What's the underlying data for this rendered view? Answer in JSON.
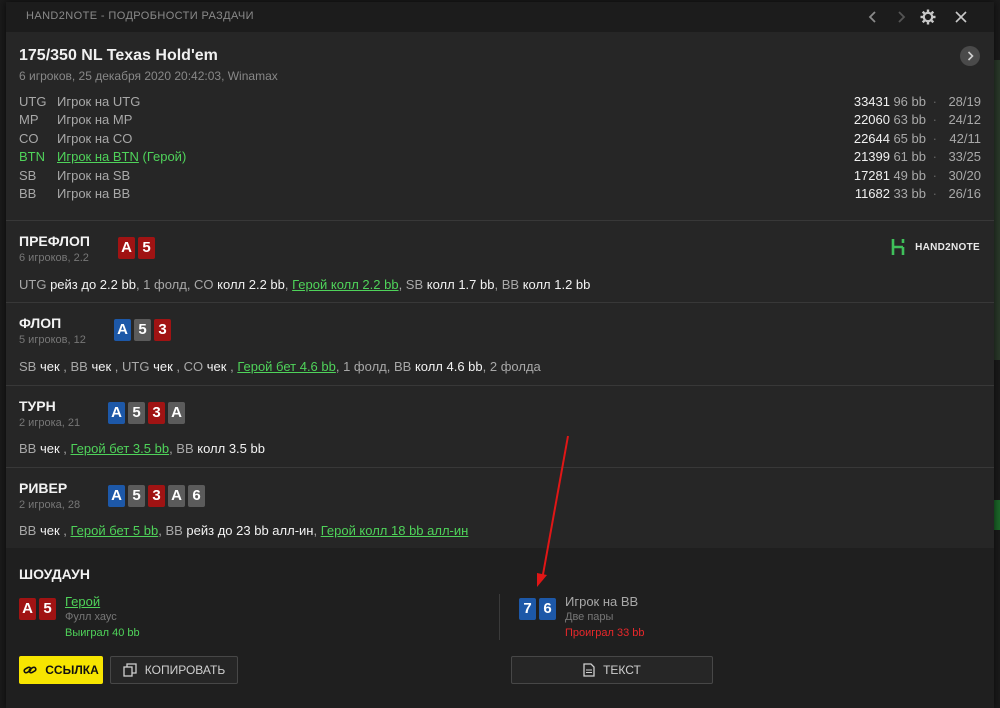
{
  "window": {
    "title": "HAND2NOTE - ПОДРОБНОСТИ РАЗДАЧИ"
  },
  "header": {
    "game_title": "175/350 NL Texas Hold'em",
    "game_subtitle": "6 игроков, 25 декабря 2020 20:42:03, Winamax"
  },
  "players": [
    {
      "pos": "UTG",
      "name": "Игрок на UTG",
      "stack": "33431",
      "bb": "96 bb",
      "ratio": "28/19",
      "hero": false
    },
    {
      "pos": "MP",
      "name": "Игрок на MP",
      "stack": "22060",
      "bb": "63 bb",
      "ratio": "24/12",
      "hero": false
    },
    {
      "pos": "CO",
      "name": "Игрок на CO",
      "stack": "22644",
      "bb": "65 bb",
      "ratio": "42/11",
      "hero": false
    },
    {
      "pos": "BTN",
      "name": "Игрок на BTN",
      "name_suffix": "(Герой)",
      "stack": "21399",
      "bb": "61 bb",
      "ratio": "33/25",
      "hero": true
    },
    {
      "pos": "SB",
      "name": "Игрок на SB",
      "stack": "17281",
      "bb": "49 bb",
      "ratio": "30/20",
      "hero": false
    },
    {
      "pos": "BB",
      "name": "Игрок на BB",
      "stack": "11682",
      "bb": "33 bb",
      "ratio": "26/16",
      "hero": false
    }
  ],
  "logo_text": "HAND2NOTE",
  "streets": {
    "preflop": {
      "name": "ПРЕФЛОП",
      "sub": "6 игроков, 2.2",
      "cards": [
        {
          "rank": "A",
          "color": "red"
        },
        {
          "rank": "5",
          "color": "red"
        }
      ],
      "actions": [
        {
          "who": "UTG",
          "act": "рейз до 2.2 bb"
        },
        {
          "sep": ", 1 фолд, "
        },
        {
          "who": "CO",
          "act": "колл 2.2 bb"
        },
        {
          "sep": ", "
        },
        {
          "hero": "Герой колл 2.2 bb"
        },
        {
          "sep": ", "
        },
        {
          "who": "SB",
          "act": "колл 1.7 bb"
        },
        {
          "sep": ", "
        },
        {
          "who": "BB",
          "act": "колл 1.2 bb"
        }
      ]
    },
    "flop": {
      "name": "ФЛОП",
      "sub": "5 игроков, 12",
      "cards": [
        {
          "rank": "A",
          "color": "blue"
        },
        {
          "rank": "5",
          "color": "gray"
        },
        {
          "rank": "3",
          "color": "red"
        }
      ],
      "actions": [
        {
          "who": "SB",
          "act": "чек"
        },
        {
          "sep": " , "
        },
        {
          "who": "BB",
          "act": "чек"
        },
        {
          "sep": " , "
        },
        {
          "who": "UTG",
          "act": "чек"
        },
        {
          "sep": " , "
        },
        {
          "who": "CO",
          "act": "чек"
        },
        {
          "sep": " , "
        },
        {
          "hero": "Герой бет 4.6 bb"
        },
        {
          "sep": ", 1 фолд, "
        },
        {
          "who": "BB",
          "act": "колл 4.6 bb"
        },
        {
          "sep": ", 2 фолда"
        }
      ]
    },
    "turn": {
      "name": "ТУРН",
      "sub": "2 игрока, 21",
      "cards": [
        {
          "rank": "A",
          "color": "blue"
        },
        {
          "rank": "5",
          "color": "gray"
        },
        {
          "rank": "3",
          "color": "red"
        },
        {
          "rank": "A",
          "color": "gray"
        }
      ],
      "actions": [
        {
          "who": "BB",
          "act": "чек"
        },
        {
          "sep": " , "
        },
        {
          "hero": "Герой бет 3.5 bb"
        },
        {
          "sep": ", "
        },
        {
          "who": "BB",
          "act": "колл 3.5 bb"
        }
      ]
    },
    "river": {
      "name": "РИВЕР",
      "sub": "2 игрока, 28",
      "cards": [
        {
          "rank": "A",
          "color": "blue"
        },
        {
          "rank": "5",
          "color": "gray"
        },
        {
          "rank": "3",
          "color": "red"
        },
        {
          "rank": "A",
          "color": "gray"
        },
        {
          "rank": "6",
          "color": "gray"
        }
      ],
      "actions": [
        {
          "who": "BB",
          "act": "чек"
        },
        {
          "sep": " , "
        },
        {
          "hero": "Герой бет 5 bb"
        },
        {
          "sep": ", "
        },
        {
          "who": "BB",
          "act": "рейз до 23 bb алл-ин"
        },
        {
          "sep": ", "
        },
        {
          "hero": "Герой колл 18 bb алл-ин"
        }
      ]
    }
  },
  "showdown": {
    "title": "ШОУДАУН",
    "hero": {
      "name": "Герой",
      "hand_type": "Фулл хаус",
      "result": "Выиграл 40 bb",
      "cards": [
        {
          "rank": "A",
          "color": "red"
        },
        {
          "rank": "5",
          "color": "red"
        }
      ]
    },
    "villain": {
      "name": "Игрок на BB",
      "hand_type": "Две пары",
      "result": "Проиграл 33 bb",
      "cards": [
        {
          "rank": "7",
          "color": "blue"
        },
        {
          "rank": "6",
          "color": "blue"
        }
      ]
    }
  },
  "buttons": {
    "link": "ССЫЛКА",
    "copy": "КОПИРОВАТЬ",
    "text": "ТЕКСТ"
  },
  "colors": {
    "hero_green": "#4fd35a",
    "win_green": "#4fd35a",
    "lose_red": "#e8282b",
    "card_red": "#a01313",
    "card_blue": "#1d58a8",
    "card_gray": "#5b5b5b",
    "accent_yellow": "#f7e500",
    "arrow_red": "#e01616"
  }
}
